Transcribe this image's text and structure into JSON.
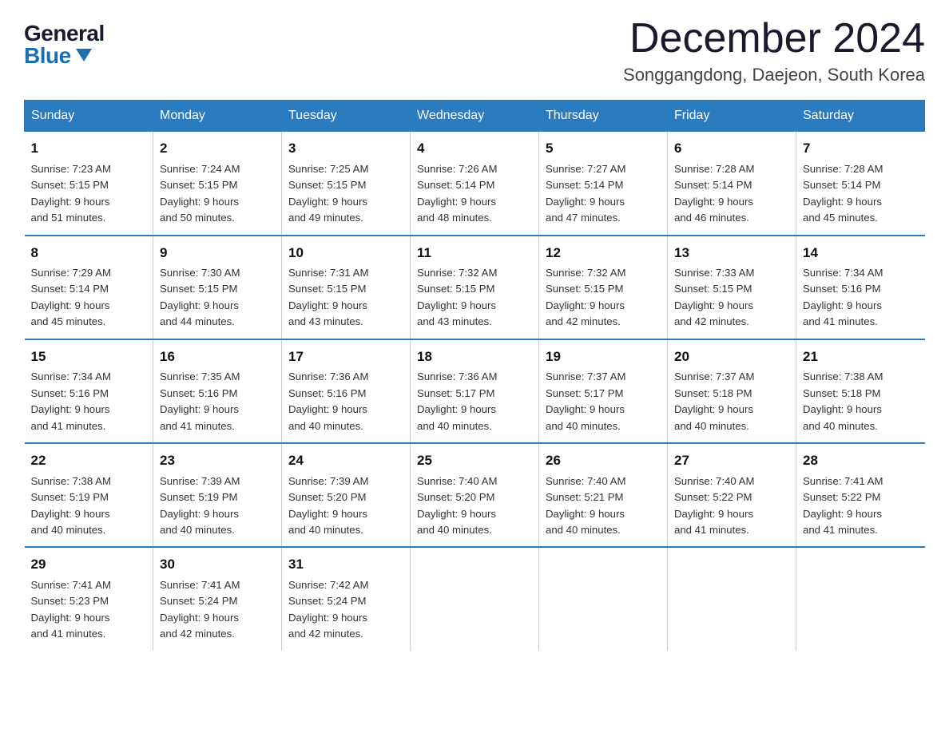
{
  "logo": {
    "general": "General",
    "blue": "Blue"
  },
  "title": "December 2024",
  "location": "Songgangdong, Daejeon, South Korea",
  "headers": [
    "Sunday",
    "Monday",
    "Tuesday",
    "Wednesday",
    "Thursday",
    "Friday",
    "Saturday"
  ],
  "weeks": [
    [
      {
        "day": "1",
        "sunrise": "7:23 AM",
        "sunset": "5:15 PM",
        "daylight": "9 hours and 51 minutes."
      },
      {
        "day": "2",
        "sunrise": "7:24 AM",
        "sunset": "5:15 PM",
        "daylight": "9 hours and 50 minutes."
      },
      {
        "day": "3",
        "sunrise": "7:25 AM",
        "sunset": "5:15 PM",
        "daylight": "9 hours and 49 minutes."
      },
      {
        "day": "4",
        "sunrise": "7:26 AM",
        "sunset": "5:14 PM",
        "daylight": "9 hours and 48 minutes."
      },
      {
        "day": "5",
        "sunrise": "7:27 AM",
        "sunset": "5:14 PM",
        "daylight": "9 hours and 47 minutes."
      },
      {
        "day": "6",
        "sunrise": "7:28 AM",
        "sunset": "5:14 PM",
        "daylight": "9 hours and 46 minutes."
      },
      {
        "day": "7",
        "sunrise": "7:28 AM",
        "sunset": "5:14 PM",
        "daylight": "9 hours and 45 minutes."
      }
    ],
    [
      {
        "day": "8",
        "sunrise": "7:29 AM",
        "sunset": "5:14 PM",
        "daylight": "9 hours and 45 minutes."
      },
      {
        "day": "9",
        "sunrise": "7:30 AM",
        "sunset": "5:15 PM",
        "daylight": "9 hours and 44 minutes."
      },
      {
        "day": "10",
        "sunrise": "7:31 AM",
        "sunset": "5:15 PM",
        "daylight": "9 hours and 43 minutes."
      },
      {
        "day": "11",
        "sunrise": "7:32 AM",
        "sunset": "5:15 PM",
        "daylight": "9 hours and 43 minutes."
      },
      {
        "day": "12",
        "sunrise": "7:32 AM",
        "sunset": "5:15 PM",
        "daylight": "9 hours and 42 minutes."
      },
      {
        "day": "13",
        "sunrise": "7:33 AM",
        "sunset": "5:15 PM",
        "daylight": "9 hours and 42 minutes."
      },
      {
        "day": "14",
        "sunrise": "7:34 AM",
        "sunset": "5:16 PM",
        "daylight": "9 hours and 41 minutes."
      }
    ],
    [
      {
        "day": "15",
        "sunrise": "7:34 AM",
        "sunset": "5:16 PM",
        "daylight": "9 hours and 41 minutes."
      },
      {
        "day": "16",
        "sunrise": "7:35 AM",
        "sunset": "5:16 PM",
        "daylight": "9 hours and 41 minutes."
      },
      {
        "day": "17",
        "sunrise": "7:36 AM",
        "sunset": "5:16 PM",
        "daylight": "9 hours and 40 minutes."
      },
      {
        "day": "18",
        "sunrise": "7:36 AM",
        "sunset": "5:17 PM",
        "daylight": "9 hours and 40 minutes."
      },
      {
        "day": "19",
        "sunrise": "7:37 AM",
        "sunset": "5:17 PM",
        "daylight": "9 hours and 40 minutes."
      },
      {
        "day": "20",
        "sunrise": "7:37 AM",
        "sunset": "5:18 PM",
        "daylight": "9 hours and 40 minutes."
      },
      {
        "day": "21",
        "sunrise": "7:38 AM",
        "sunset": "5:18 PM",
        "daylight": "9 hours and 40 minutes."
      }
    ],
    [
      {
        "day": "22",
        "sunrise": "7:38 AM",
        "sunset": "5:19 PM",
        "daylight": "9 hours and 40 minutes."
      },
      {
        "day": "23",
        "sunrise": "7:39 AM",
        "sunset": "5:19 PM",
        "daylight": "9 hours and 40 minutes."
      },
      {
        "day": "24",
        "sunrise": "7:39 AM",
        "sunset": "5:20 PM",
        "daylight": "9 hours and 40 minutes."
      },
      {
        "day": "25",
        "sunrise": "7:40 AM",
        "sunset": "5:20 PM",
        "daylight": "9 hours and 40 minutes."
      },
      {
        "day": "26",
        "sunrise": "7:40 AM",
        "sunset": "5:21 PM",
        "daylight": "9 hours and 40 minutes."
      },
      {
        "day": "27",
        "sunrise": "7:40 AM",
        "sunset": "5:22 PM",
        "daylight": "9 hours and 41 minutes."
      },
      {
        "day": "28",
        "sunrise": "7:41 AM",
        "sunset": "5:22 PM",
        "daylight": "9 hours and 41 minutes."
      }
    ],
    [
      {
        "day": "29",
        "sunrise": "7:41 AM",
        "sunset": "5:23 PM",
        "daylight": "9 hours and 41 minutes."
      },
      {
        "day": "30",
        "sunrise": "7:41 AM",
        "sunset": "5:24 PM",
        "daylight": "9 hours and 42 minutes."
      },
      {
        "day": "31",
        "sunrise": "7:42 AM",
        "sunset": "5:24 PM",
        "daylight": "9 hours and 42 minutes."
      },
      null,
      null,
      null,
      null
    ]
  ],
  "labels": {
    "sunrise": "Sunrise:",
    "sunset": "Sunset:",
    "daylight": "Daylight:"
  }
}
